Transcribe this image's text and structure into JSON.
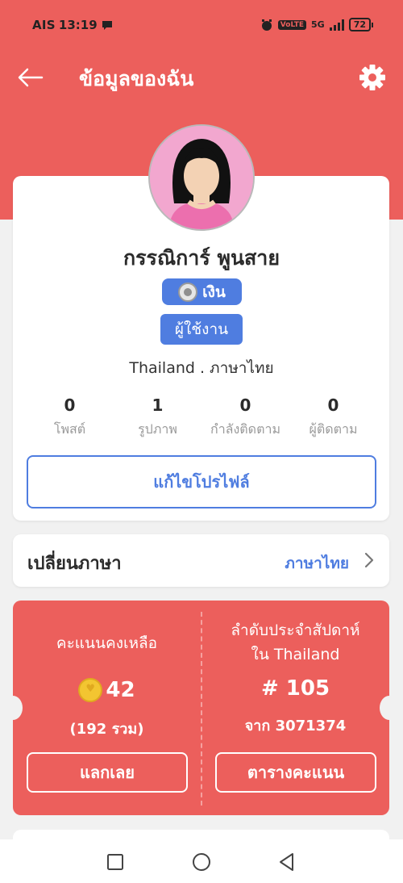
{
  "status_bar": {
    "carrier": "AIS",
    "time": "13:19",
    "volte": "VoLTE",
    "network": "5G",
    "battery": "72"
  },
  "header": {
    "title": "ข้อมูลของฉัน"
  },
  "profile": {
    "name": "กรรณิการ์ พูนสาย",
    "rank_badge": "เงิน",
    "role_badge": "ผู้ใช้งาน",
    "locale": "Thailand . ภาษาไทย",
    "stats": [
      {
        "value": "0",
        "label": "โพสต์"
      },
      {
        "value": "1",
        "label": "รูปภาพ"
      },
      {
        "value": "0",
        "label": "กำลังติดตาม"
      },
      {
        "value": "0",
        "label": "ผู้ติดตาม"
      }
    ],
    "edit_button": "แก้ไขโปรไฟล์"
  },
  "language": {
    "label": "เปลี่ยนภาษา",
    "value": "ภาษาไทย"
  },
  "score": {
    "remaining_label": "คะแนนคงเหลือ",
    "coins": "42",
    "total": "(192 รวม)",
    "redeem_button": "แลกเลย",
    "rank_label_line1": "ลำดับประจำสัปดาห์",
    "rank_label_line2": "ใน Thailand",
    "rank_number": "# 105",
    "rank_of": "จาก 3071374",
    "leaderboard_button": "ตารางคะแนน"
  },
  "colors": {
    "primary": "#ec5f5c",
    "accent": "#4f7de0"
  }
}
